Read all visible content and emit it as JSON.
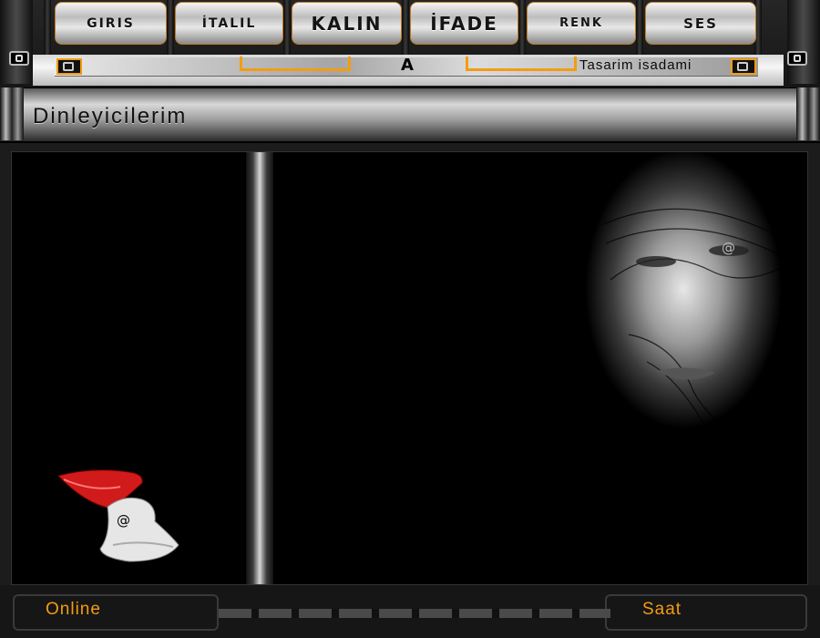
{
  "menu": {
    "items": [
      {
        "label": "GIRIS"
      },
      {
        "label": "İTALIL"
      },
      {
        "label": "KALIN"
      },
      {
        "label": "İFADE"
      },
      {
        "label": "RENK"
      },
      {
        "label": "SES"
      }
    ]
  },
  "toolbar": {
    "logo_glyph": "A",
    "credit": "Tasarim isadami"
  },
  "page": {
    "title": "Dinleyicilerim"
  },
  "footer": {
    "online_label": "Online",
    "clock_label": "Saat"
  },
  "decor": {
    "at_symbol": "@"
  },
  "colors": {
    "accent": "#f39c12",
    "background": "#000000",
    "lips_red": "#d11a1a"
  }
}
